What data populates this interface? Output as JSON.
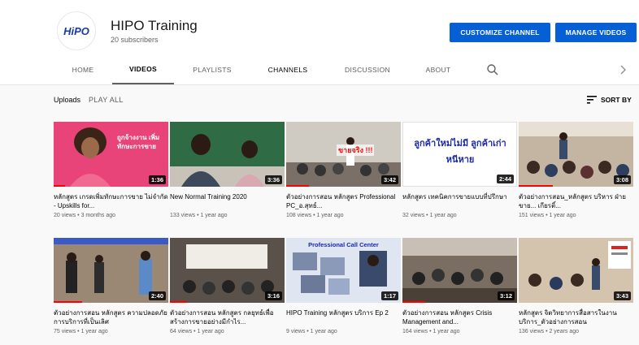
{
  "channel": {
    "avatar_text": "HiPO",
    "name": "HIPO Training",
    "subscribers": "20 subscribers",
    "customize_label": "CUSTOMIZE CHANNEL",
    "manage_label": "MANAGE VIDEOS"
  },
  "tabs": [
    {
      "label": "HOME"
    },
    {
      "label": "VIDEOS"
    },
    {
      "label": "PLAYLISTS"
    },
    {
      "label": "CHANNELS"
    },
    {
      "label": "DISCUSSION"
    },
    {
      "label": "ABOUT"
    }
  ],
  "uploads": {
    "label": "Uploads",
    "play_all": "PLAY ALL",
    "sort_label": "SORT BY"
  },
  "videos": [
    {
      "title": "หลักสูตร เกรดเพิ่มทักษะการขาย ไม่จำกัด - Upskills for...",
      "meta": "20 views • 3 months ago",
      "duration": "1:36",
      "progress": 0.1,
      "thumb_text": "ถูกจ้างงาน เพิ่มทักษะการขาย"
    },
    {
      "title": "New Normal Training 2020",
      "meta": "133 views • 1 year ago",
      "duration": "3:36",
      "progress": 0.0,
      "thumb_text": ""
    },
    {
      "title": "ตัวอย่างการสอน หลักสูตร Professional PC_อ.สุทธ์...",
      "meta": "108 views • 1 year ago",
      "duration": "3:42",
      "progress": 0.2,
      "thumb_text": "ขายจริง !!!"
    },
    {
      "title": "หลักสูตร เทคนิคการขายแบบที่ปรึกษา",
      "meta": "32 views • 1 year ago",
      "duration": "2:44",
      "progress": 0.0,
      "thumb_text": "ลูกค้าใหม่ไม่มี ลูกค้าเก่าหนีหาย"
    },
    {
      "title": "ตัวอย่างการสอน_หลักสูตร บริหาร ฝ่ายขาย... เกียรติ์...",
      "meta": "151 views • 1 year ago",
      "duration": "3:08",
      "progress": 0.3,
      "thumb_text": ""
    },
    {
      "title": "ตัวอย่างการสอน หลักสูตร ความปลอดภัยการบริการที่เป็นเลิศ",
      "meta": "75 views • 1 year ago",
      "duration": "2:40",
      "progress": 0.25,
      "thumb_text": ""
    },
    {
      "title": "ตัวอย่างการสอน หลักสูตร กลยุทธ์เพื่อสร้างการขายอย่างมีกำไร...",
      "meta": "64 views • 1 year ago",
      "duration": "3:16",
      "progress": 0.15,
      "thumb_text": ""
    },
    {
      "title": "HIPO Training หลักสูตร บริการ Ep 2",
      "meta": "9 views • 1 year ago",
      "duration": "1:17",
      "progress": 0.0,
      "thumb_text": "Professional Call Center"
    },
    {
      "title": "ตัวอย่างการสอน หลักสูตร Crisis Management and...",
      "meta": "164 views • 1 year ago",
      "duration": "3:12",
      "progress": 0.2,
      "thumb_text": ""
    },
    {
      "title": "หลักสูตร จิตวิทยาการสื่อสารในงานบริการ_ตัวอย่างการสอน",
      "meta": "136 views • 2 years ago",
      "duration": "3:43",
      "progress": 0.0,
      "thumb_text": ""
    }
  ],
  "colors": {
    "accent": "#065fd4",
    "progress": "#ff0000"
  }
}
